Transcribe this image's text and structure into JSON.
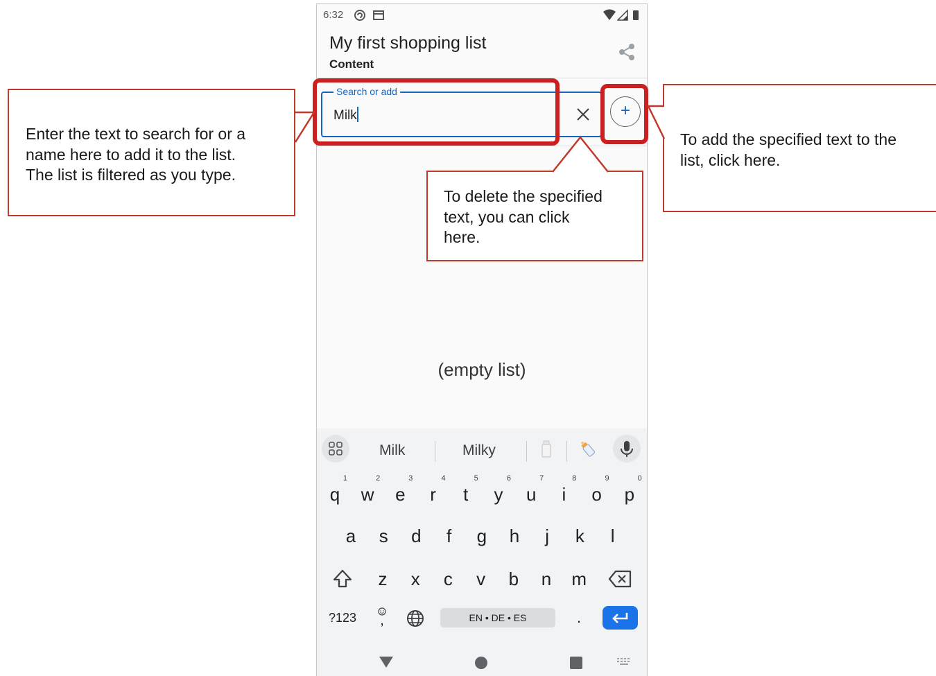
{
  "status_bar": {
    "time": "6:32"
  },
  "app_bar": {
    "title": "My first shopping list",
    "subtitle": "Content"
  },
  "search": {
    "label": "Search or add",
    "value": "Milk"
  },
  "list": {
    "empty_text": "(empty list)"
  },
  "keyboard": {
    "suggestions": [
      "Milk",
      "Milky"
    ],
    "row1": [
      {
        "key": "q",
        "hint": "1"
      },
      {
        "key": "w",
        "hint": "2"
      },
      {
        "key": "e",
        "hint": "3"
      },
      {
        "key": "r",
        "hint": "4"
      },
      {
        "key": "t",
        "hint": "5"
      },
      {
        "key": "y",
        "hint": "6"
      },
      {
        "key": "u",
        "hint": "7"
      },
      {
        "key": "i",
        "hint": "8"
      },
      {
        "key": "o",
        "hint": "9"
      },
      {
        "key": "p",
        "hint": "0"
      }
    ],
    "row2": [
      "a",
      "s",
      "d",
      "f",
      "g",
      "h",
      "j",
      "k",
      "l"
    ],
    "row3": [
      "z",
      "x",
      "c",
      "v",
      "b",
      "n",
      "m"
    ],
    "symbols_label": "?123",
    "comma_label": ",",
    "period_label": ".",
    "space_label": "EN • DE • ES"
  },
  "callouts": {
    "search_lines": [
      "Enter the text to search for or a",
      "name here to add it to the list.",
      "The list is filtered as you type."
    ],
    "clear_lines": [
      "To delete the specified",
      "text, you can click",
      "here."
    ],
    "add_lines": [
      "To add the specified text to the",
      "list, click here."
    ]
  },
  "colors": {
    "accent": "#1565c0",
    "highlight": "#cc1f1f",
    "callout_border": "#c0392b",
    "enter_key": "#1a73e8"
  }
}
